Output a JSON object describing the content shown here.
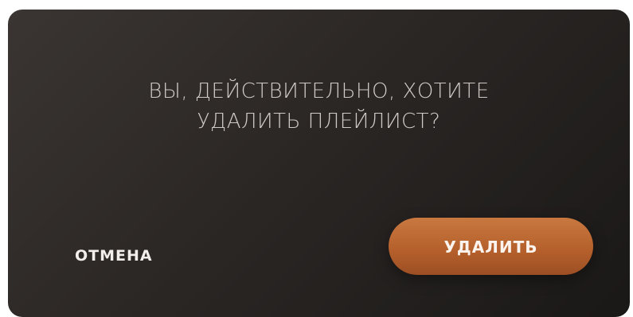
{
  "dialog": {
    "message_line1": "ВЫ, ДЕЙСТВИТЕЛЬНО, ХОТИТЕ",
    "message_line2": "УДАЛИТЬ ПЛЕЙЛИСТ?",
    "cancel_label": "ОТМЕНА",
    "delete_label": "УДАЛИТЬ"
  },
  "colors": {
    "background": "#2b2725",
    "accent": "#b45f2b",
    "text": "#cfcac6"
  }
}
